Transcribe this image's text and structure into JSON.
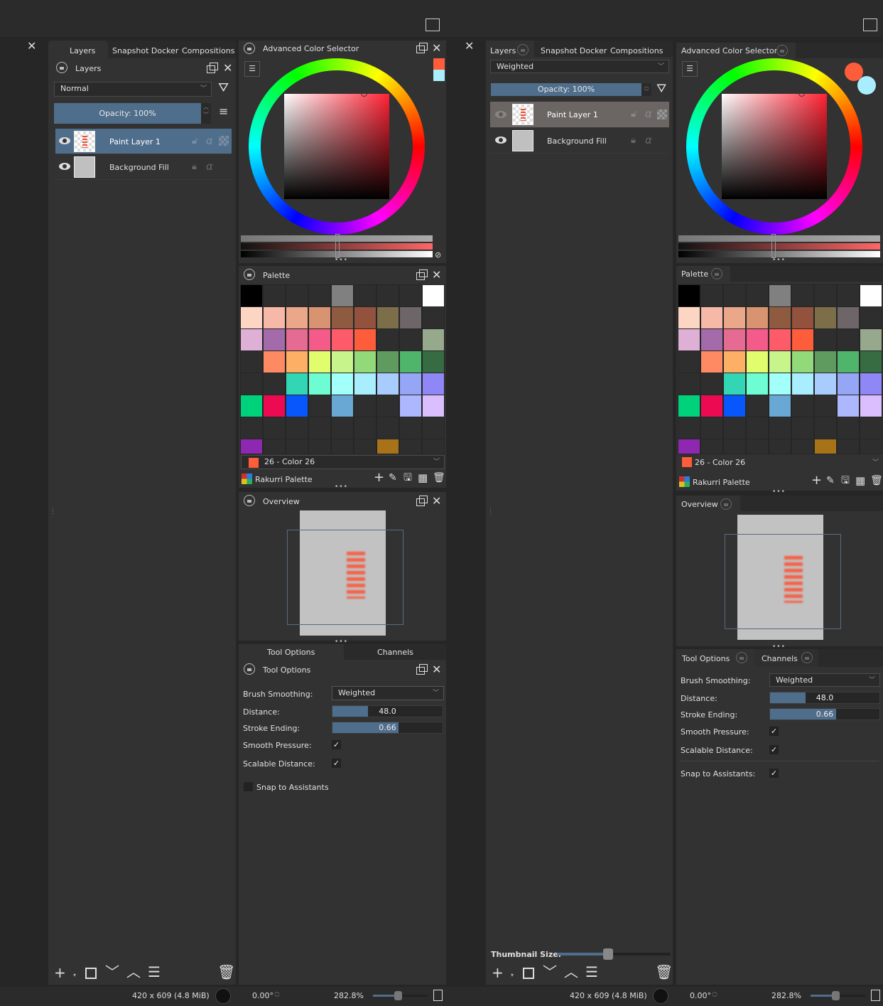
{
  "left": {
    "tabs": [
      "Layers",
      "Snapshot Docker",
      "Compositions"
    ],
    "layers_header": "Layers",
    "blend_mode": "Normal",
    "opacity": "Opacity:  100%",
    "layers": [
      {
        "name": "Paint Layer 1",
        "selected": true
      },
      {
        "name": "Background Fill",
        "selected": false
      }
    ],
    "color_selector_title": "Advanced Color Selector",
    "palette_title": "Palette",
    "current_color": "26 - Color 26",
    "palette_name": "Rakurri Palette",
    "overview_title": "Overview",
    "tool_tabs": [
      "Tool Options",
      "Channels"
    ],
    "tool_options_title": "Tool Options",
    "tool_options": {
      "brush_smoothing_label": "Brush Smoothing:",
      "brush_smoothing": "Weighted",
      "distance_label": "Distance:",
      "distance": "48.0",
      "stroke_ending_label": "Stroke Ending:",
      "stroke_ending": "0.66",
      "smooth_pressure_label": "Smooth Pressure:",
      "scalable_distance_label": "Scalable Distance:",
      "snap_label": "Snap to Assistants"
    }
  },
  "right": {
    "tabs": [
      "Layers",
      "Snapshot Docker",
      "Compositions"
    ],
    "blend_mode": "Weighted",
    "opacity": "Opacity:  100%",
    "layers": [
      {
        "name": "Paint Layer 1",
        "selected": true
      },
      {
        "name": "Background Fill",
        "selected": false
      }
    ],
    "thumbnail_size_label": "Thumbnail Size:",
    "thumbnail_size": 0.45,
    "color_selector_title": "Advanced Color Selector",
    "palette_title": "Palette",
    "current_color": "26 - Color 26",
    "palette_name": "Rakurri Palette",
    "overview_title": "Overview",
    "tool_tabs": [
      "Tool Options",
      "Channels"
    ],
    "tool_options": {
      "brush_smoothing_label": "Brush Smoothing:",
      "brush_smoothing": "Weighted",
      "distance_label": "Distance:",
      "distance": "48.0",
      "stroke_ending_label": "Stroke Ending:",
      "stroke_ending": "0.66",
      "smooth_pressure_label": "Smooth Pressure:",
      "scalable_distance_label": "Scalable Distance:",
      "snap_label": "Snap to Assistants:"
    }
  },
  "status": {
    "size": "420 x 609 (4.8 MiB)",
    "rotation": "0.00°",
    "zoom": "282.8%",
    "zoom_slider": 0.45
  },
  "colors": {
    "accent": "#4f6e8c",
    "fg": "#fe5d3b",
    "bg": "#a9eefe",
    "current": "#fe5d3b"
  },
  "palette": [
    [
      "#000000",
      null,
      null,
      null,
      "#808080",
      null,
      null,
      null,
      "#ffffff"
    ],
    [
      "#fdd5c3",
      "#f6b9a7",
      "#eba78a",
      "#d89370",
      "#8f5b40",
      "#92523e",
      "#7c6e48",
      "#6d6568",
      null
    ],
    [
      "#deb0d6",
      "#a46baa",
      "#e66b92",
      "#f45a8a",
      "#fd5a6a",
      "#fe5d3b",
      null,
      null,
      "#96a98d"
    ],
    [
      null,
      "#fe8a64",
      "#fdaf65",
      "#e1fd6e",
      "#c7f58b",
      "#92d97a",
      "#5f9b5f",
      "#4fb56b",
      "#376b41"
    ],
    [
      null,
      null,
      "#32d6b5",
      "#6efdd3",
      "#a2fffa",
      "#a9eefe",
      "#a9ccfe",
      "#96a6f6",
      "#8f87f6"
    ],
    [
      "#00d27c",
      "#ec0b53",
      "#0857fd",
      null,
      "#69a8d4",
      null,
      null,
      "#adb7fd",
      "#dbbefd"
    ],
    [
      null,
      null,
      null,
      null,
      null,
      null,
      null,
      null,
      null
    ],
    [
      "#8f28b0",
      null,
      null,
      null,
      null,
      null,
      "#a77218",
      null,
      null
    ]
  ]
}
